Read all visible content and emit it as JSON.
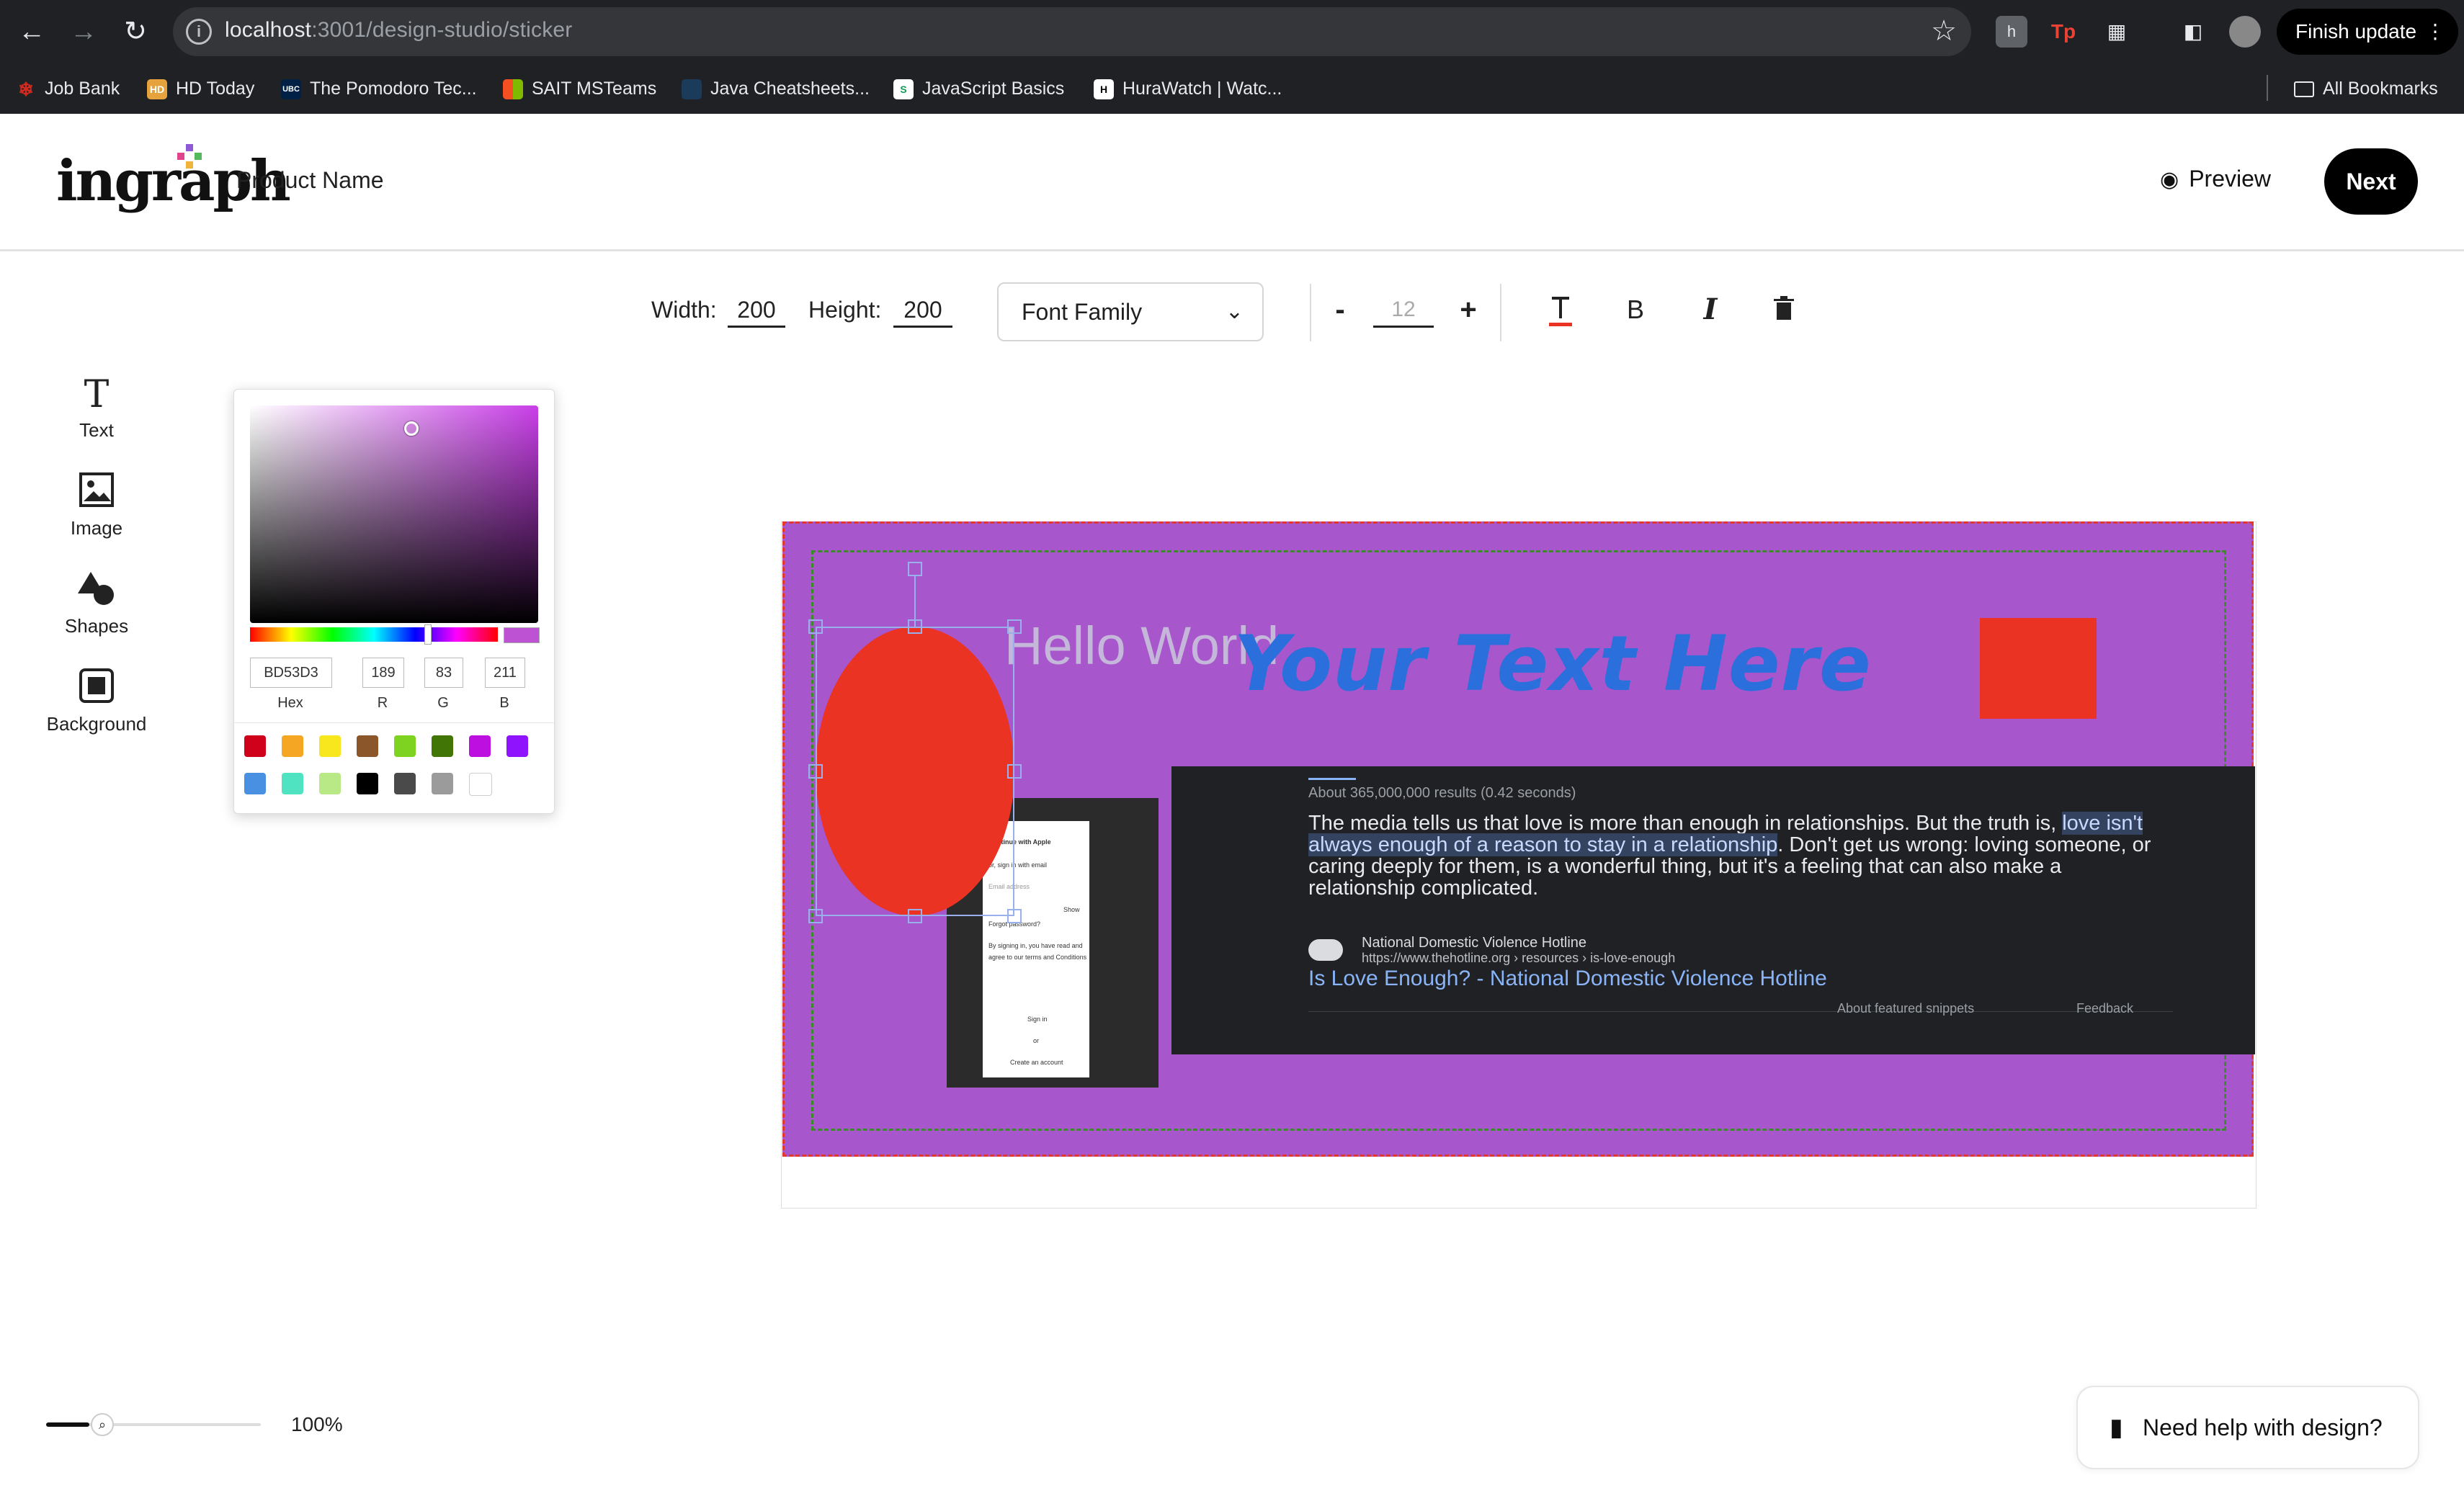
{
  "browser": {
    "url_host": "localhost",
    "url_rest": ":3001/design-studio/sticker",
    "finish_update": "Finish update",
    "all_bookmarks": "All Bookmarks",
    "bookmarks": [
      {
        "label": "Job Bank",
        "icon": "maple-leaf-icon",
        "color": "#d52b1e"
      },
      {
        "label": "HD Today",
        "icon": "hd-icon",
        "color": "#e6a23c"
      },
      {
        "label": "The Pomodoro Tec...",
        "icon": "ubc-icon",
        "color": "#002145"
      },
      {
        "label": "SAIT MSTeams",
        "icon": "microsoft-icon",
        "color": "#f25022"
      },
      {
        "label": "Java Cheatsheets...",
        "icon": "java-icon",
        "color": "#1a3c5a"
      },
      {
        "label": "JavaScript Basics",
        "icon": "s-icon",
        "color": "#ffffff"
      },
      {
        "label": "HuraWatch | Watc...",
        "icon": "h-icon",
        "color": "#ffffff"
      }
    ]
  },
  "header": {
    "logo": "ingraph",
    "product_name": "Product Name",
    "preview": "Preview",
    "next": "Next"
  },
  "toolbar": {
    "width_label": "Width:",
    "width_value": "200",
    "height_label": "Height:",
    "height_value": "200",
    "font_family": "Font Family",
    "minus": "-",
    "font_size": "12",
    "plus": "+",
    "bold": "B",
    "italic": "I"
  },
  "tools": [
    {
      "label": "Text",
      "icon": "text-icon"
    },
    {
      "label": "Image",
      "icon": "image-icon"
    },
    {
      "label": "Shapes",
      "icon": "shapes-icon"
    },
    {
      "label": "Background",
      "icon": "background-icon"
    }
  ],
  "color_picker": {
    "hex": "BD53D3",
    "r": "189",
    "g": "83",
    "b": "211",
    "hex_label": "Hex",
    "r_label": "R",
    "g_label": "G",
    "b_label": "B",
    "current_color": "#BD53D3",
    "preset_colors": [
      "#d0021b",
      "#f5a623",
      "#f8e71c",
      "#8b572a",
      "#7ed321",
      "#417505",
      "#bd10e0",
      "#9013fe",
      "#4a90e2",
      "#50e3c2",
      "#b8e986",
      "#000000",
      "#4a4a4a",
      "#9b9b9b",
      "#ffffff"
    ]
  },
  "canvas": {
    "background_color": "#a856cc",
    "hello_text": "Hello World",
    "your_text": "Your Text Here",
    "shape_color": "#ea3323",
    "serp": {
      "results_info": "About 365,000,000 results (0.42 seconds)",
      "snippet_pre": "The media tells us that love is more than enough in relationships. But the truth is, ",
      "snippet_highlight": "love isn't always enough of a reason to stay in a relationship",
      "snippet_post": ". Don't get us wrong: loving someone, or caring deeply for them, is a wonderful thing, but it's a feeling that can also make a relationship complicated.",
      "source_name": "National Domestic Violence Hotline",
      "source_url": "https://www.thehotline.org › resources › is-love-enough",
      "link_title": "Is Love Enough? - National Domestic Violence Hotline",
      "about_snippets": "About featured snippets",
      "feedback": "Feedback"
    },
    "phone": {
      "line1": "Continue with Apple",
      "line2": "or, sign in with email",
      "line3": "Email address",
      "line4": "Show",
      "line5": "Forgot password?",
      "line6": "By signing in, you have read and",
      "line7": "agree to our terms and Conditions",
      "line8": "Sign in",
      "line9": "or",
      "line10": "Create an account"
    }
  },
  "bottom": {
    "zoom": "100%",
    "help": "Need help with design?"
  }
}
